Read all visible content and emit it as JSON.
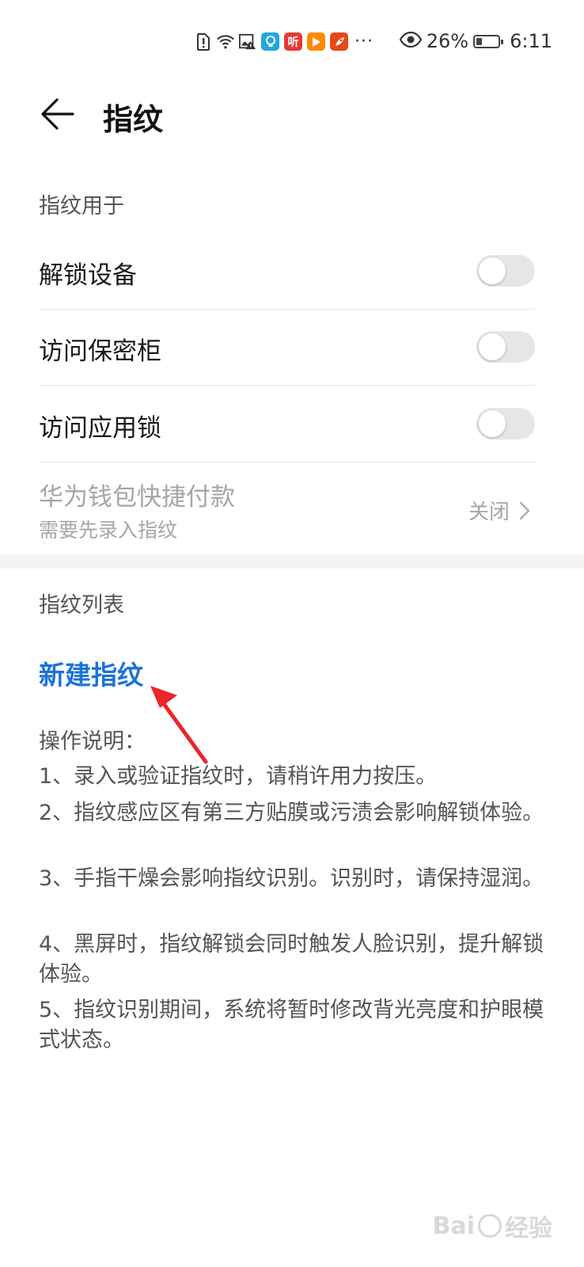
{
  "status_bar": {
    "battery_percent": "26%",
    "time": "6:11",
    "app_icons": [
      {
        "label": "",
        "color": "#1fa8e0",
        "icon": "lightbulb-app-icon"
      },
      {
        "label": "听",
        "color": "#e53935",
        "icon": "ting-app-icon"
      },
      {
        "label": "",
        "color": "#ff8a00",
        "icon": "play-app-icon"
      },
      {
        "label": "",
        "color": "#e64a19",
        "icon": "rocket-app-icon"
      }
    ],
    "more": "···"
  },
  "header": {
    "title": "指纹"
  },
  "usage_section": {
    "label": "指纹用于",
    "items": [
      {
        "label": "解锁设备",
        "enabled": false
      },
      {
        "label": "访问保密柜",
        "enabled": false
      },
      {
        "label": "访问应用锁",
        "enabled": false
      }
    ],
    "wallet": {
      "label": "华为钱包快捷付款",
      "sublabel": "需要先录入指纹",
      "value": "关闭"
    }
  },
  "list_section": {
    "label": "指纹列表",
    "new_fingerprint": "新建指纹"
  },
  "instructions": {
    "title": "操作说明：",
    "lines": [
      "1、录入或验证指纹时，请稍许用力按压。",
      "2、指纹感应区有第三方贴膜或污渍会影响解锁体验。",
      "3、手指干燥会影响指纹识别。识别时，请保持湿润。",
      "4、黑屏时，指纹解锁会同时触发人脸识别，提升解锁体验。",
      "5、指纹识别期间，系统将暂时修改背光亮度和护眼模式状态。"
    ]
  },
  "watermark": {
    "text": "Bai",
    "text2": "经验"
  },
  "colors": {
    "accent": "#1a73d9",
    "arrow": "#e8262b"
  }
}
